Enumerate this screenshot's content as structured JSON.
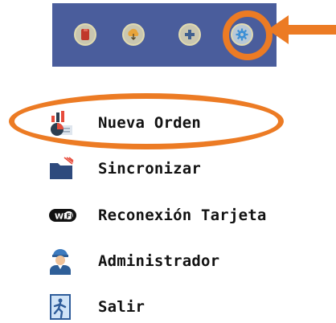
{
  "toolbar": {
    "background": "#4a5d9c",
    "buttons": [
      {
        "icon": "document-icon"
      },
      {
        "icon": "cloud-sync-icon"
      },
      {
        "icon": "plus-icon"
      },
      {
        "icon": "gear-icon"
      }
    ]
  },
  "annotation": {
    "color": "#ec7b24"
  },
  "menu": {
    "items": [
      {
        "label": "Nueva Orden",
        "icon": "chart-report-icon"
      },
      {
        "label": "Sincronizar",
        "icon": "folder-icon"
      },
      {
        "label": "Reconexión Tarjeta",
        "icon": "wifi-icon"
      },
      {
        "label": "Administrador",
        "icon": "worker-icon"
      },
      {
        "label": "Salir",
        "icon": "exit-door-icon"
      }
    ]
  }
}
